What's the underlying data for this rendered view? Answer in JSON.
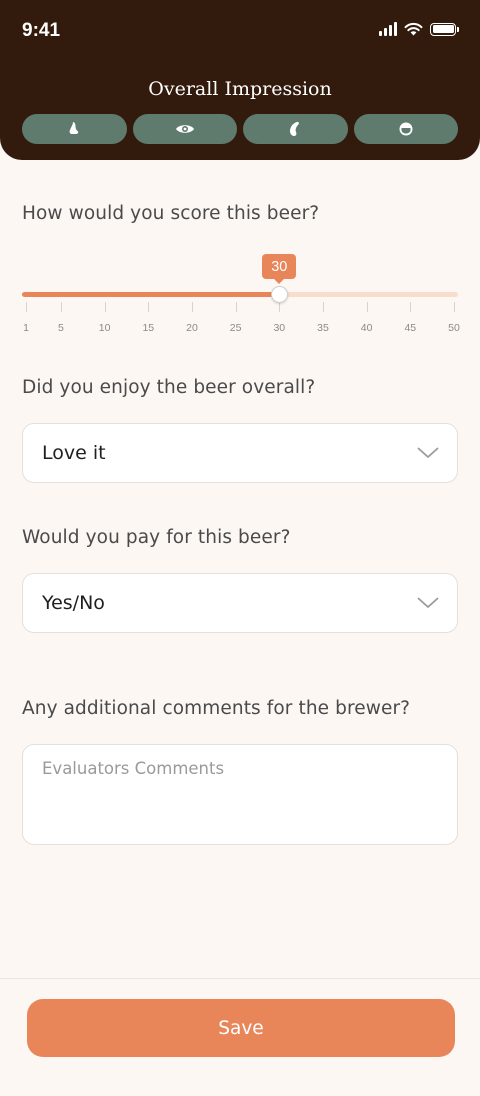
{
  "status_bar": {
    "time": "9:41"
  },
  "header": {
    "title": "Overall Impression",
    "tabs": [
      {
        "icon": "nose-icon"
      },
      {
        "icon": "eye-icon"
      },
      {
        "icon": "taste-icon"
      },
      {
        "icon": "mouthfeel-icon"
      }
    ]
  },
  "score": {
    "question": "How would you score this beer?",
    "value": 30,
    "value_label": "30",
    "min": 1,
    "max": 50,
    "tick_labels": [
      "1",
      "5",
      "10",
      "15",
      "20",
      "25",
      "30",
      "35",
      "40",
      "45",
      "50"
    ]
  },
  "enjoy": {
    "question": "Did you enjoy the beer overall?",
    "selected": "Love it"
  },
  "pay": {
    "question": "Would you pay for this beer?",
    "selected": "Yes/No"
  },
  "comments": {
    "question": "Any additional comments for the brewer?",
    "placeholder": "Evaluators Comments"
  },
  "footer": {
    "save_label": "Save"
  },
  "colors": {
    "header_bg": "#321a0c",
    "tab_bg": "#5e7b6e",
    "accent": "#e8865a",
    "page_bg": "#fdf7f3"
  }
}
